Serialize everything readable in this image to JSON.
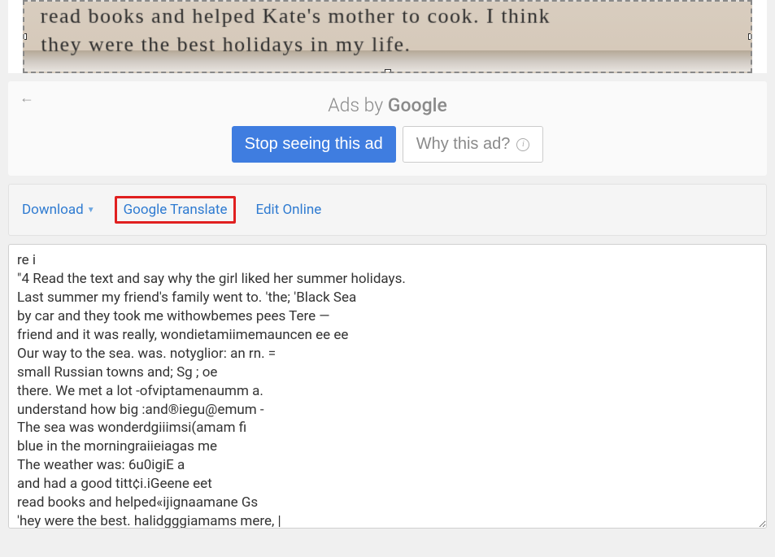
{
  "image_crop": {
    "visible_text_line1": "read books and helped Kate's mother to cook. I think",
    "visible_text_line2": "they were the best holidays in my life."
  },
  "ads": {
    "byline_prefix": "Ads by ",
    "byline_brand": "Google",
    "stop_label": "Stop seeing this ad",
    "why_label": "Why this ad?"
  },
  "toolbar": {
    "download_label": "Download",
    "translate_label": "Google Translate",
    "edit_label": "Edit Online"
  },
  "output": {
    "text": "re i\n\"4 Read the text and say why the girl liked her summer holidays.\nLast summer my friend's family went to. 'the; 'Black Sea\nby car and they took me withowbemes pees Tere —\nfriend and it was really, wondietamiimemauncen ee ee\nOur way to the sea. was. notyglior: an rn. =\nsmall Russian towns and; Sg ; oe\nthere. We met a lot -ofviptamenaumm a.\nunderstand how big :and®iegu@emum -\nThe sea was wonderdgiiimsi(amam fi\nblue in the morningraiieiagas me\nThe weather was: 6u0igiE a\nand had a good titt¢i.iGeene eet\nread books and helped«ijignaamane Gs\n'hey were the best. halidgggiamams mere, |"
  }
}
